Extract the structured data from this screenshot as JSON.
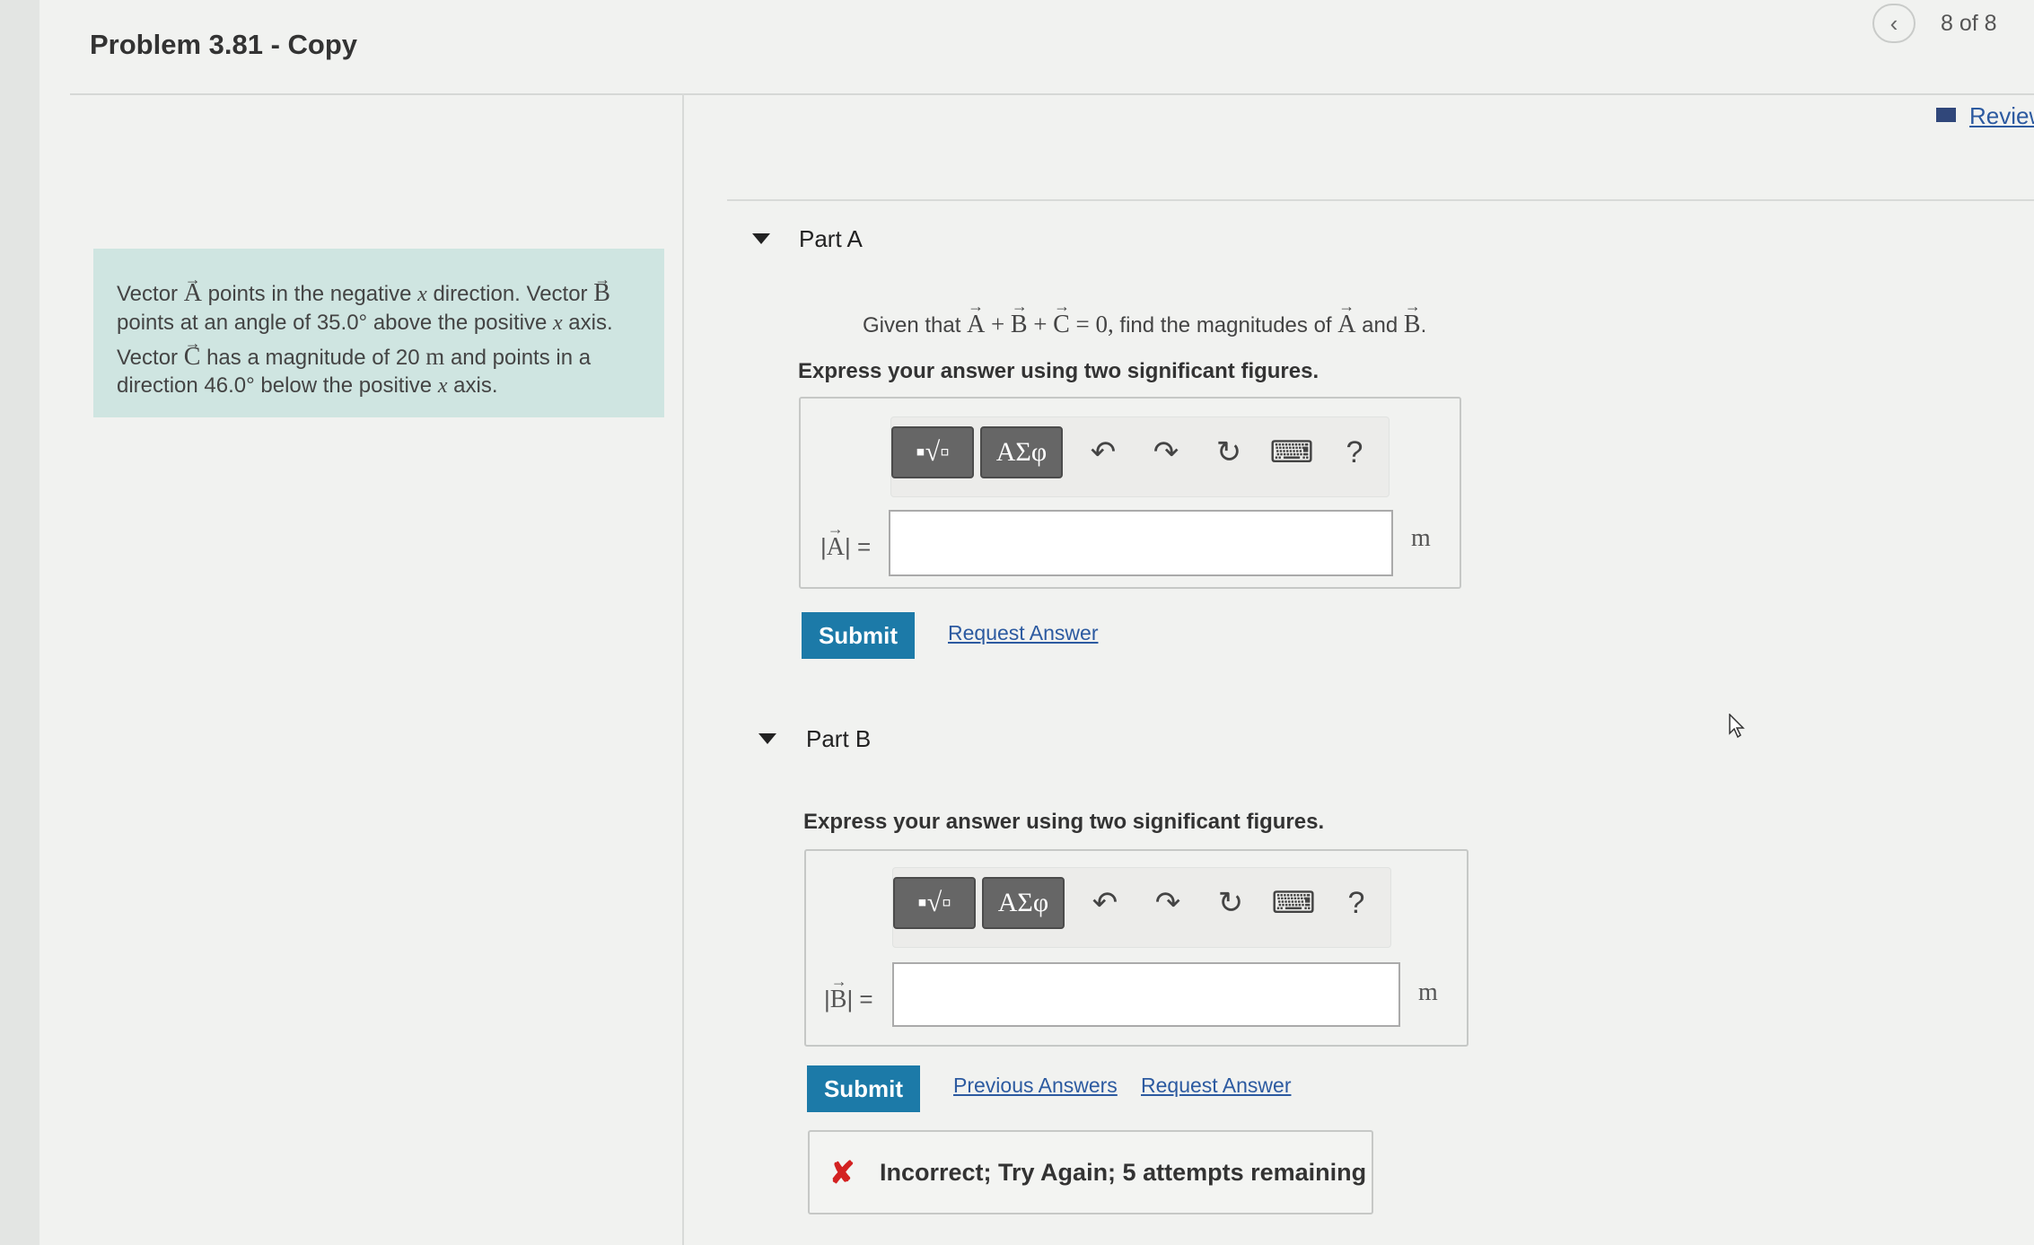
{
  "header": {
    "title": "Problem 3.81 - Copy",
    "page_counter": "8 of 8",
    "review_label": "Review"
  },
  "problem": {
    "line1_pre": "Vector",
    "vecA": "A",
    "line1_mid": "points in the negative",
    "x": "x",
    "line1_post": "direction. Vector",
    "vecB": "B",
    "line2_pre": "points at an angle of 35.0",
    "deg": "°",
    "line2_post": "above the positive",
    "axis": "axis.",
    "line3_pre": "Vector",
    "vecC": "C",
    "line3_mid": "has a magnitude of 20",
    "unit_m": "m",
    "line3_post": "and points in a",
    "line4_pre": "direction 46.0",
    "line4_post": "below the positive"
  },
  "partA": {
    "label": "Part A",
    "given_pre": "Given that",
    "plus": "+",
    "eq": "= 0,",
    "given_mid": "find the magnitudes of",
    "and": "and",
    "given_post": ".",
    "instruction": "Express your answer using two significant figures.",
    "answer_label_pre": "|",
    "answer_label_post": "| =",
    "unit": "m",
    "submit": "Submit",
    "request": "Request Answer"
  },
  "partB": {
    "label": "Part B",
    "instruction": "Express your answer using two significant figures.",
    "answer_label_pre": "|",
    "answer_label_post": "| =",
    "unit": "m",
    "submit": "Submit",
    "previous": "Previous Answers",
    "request": "Request Answer",
    "feedback_icon": "✘",
    "feedback": "Incorrect; Try Again; 5 attempts remaining"
  },
  "toolbar": {
    "templates_label": "▪√▫",
    "symbols_label": "ΑΣφ",
    "undo_icon": "↶",
    "redo_icon": "↷",
    "reset_icon": "↻",
    "keyboard_icon": "⌨",
    "help_icon": "?"
  },
  "colors": {
    "problem_bg": "#cfe5e1",
    "submit_bg": "#1c7aa8",
    "link": "#2c5aa0",
    "error": "#d32222"
  }
}
